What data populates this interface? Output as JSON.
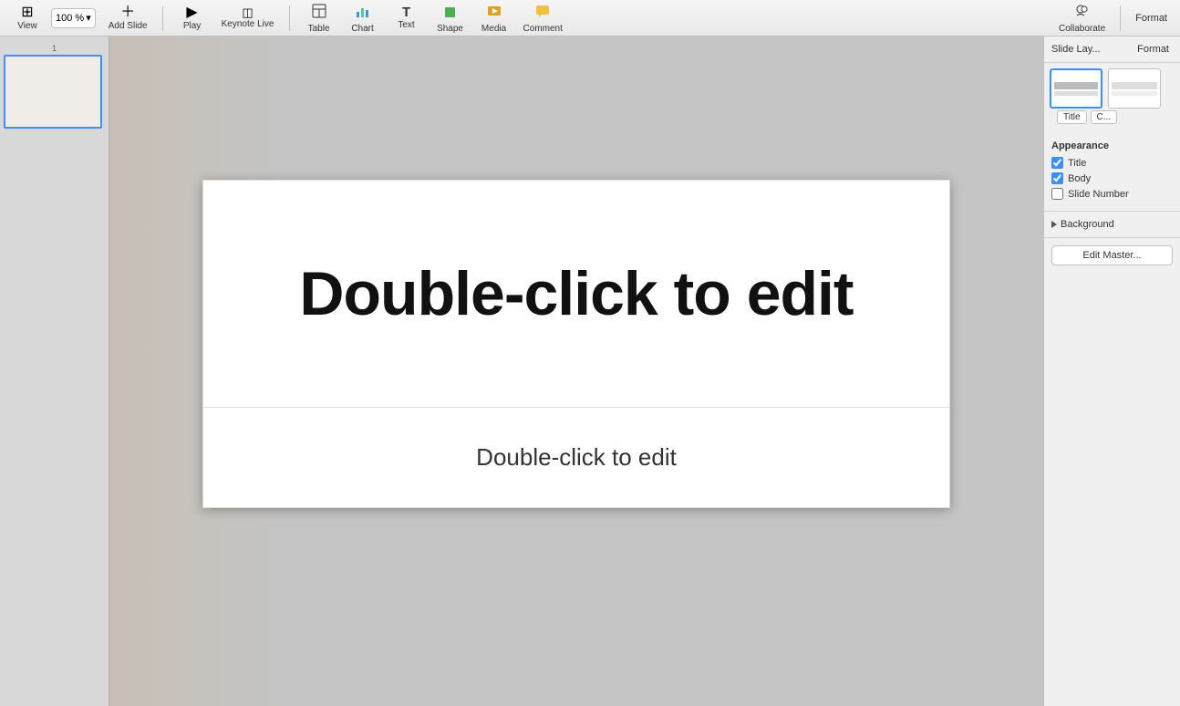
{
  "toolbar": {
    "view_label": "View",
    "zoom_value": "100 %",
    "add_slide_label": "Add Slide",
    "play_label": "Play",
    "keynote_live_label": "Keynote Live",
    "table_label": "Table",
    "chart_label": "Chart",
    "text_label": "Text",
    "shape_label": "Shape",
    "media_label": "Media",
    "comment_label": "Comment",
    "collaborate_label": "Collaborate",
    "format_label": "Format"
  },
  "slide_panel": {
    "slide_number": "1"
  },
  "canvas": {
    "title_placeholder": "Double-click to edit",
    "body_placeholder": "Double-click to edit"
  },
  "right_panel": {
    "header_label": "Slide Lay...",
    "layout_title_label": "Title",
    "layout_center_label": "C...",
    "appearance_title": "Appearance",
    "title_label": "Title",
    "body_label": "Body",
    "slide_number_label": "Slide Number",
    "background_label": "Background",
    "edit_master_label": "Edit Master..."
  }
}
